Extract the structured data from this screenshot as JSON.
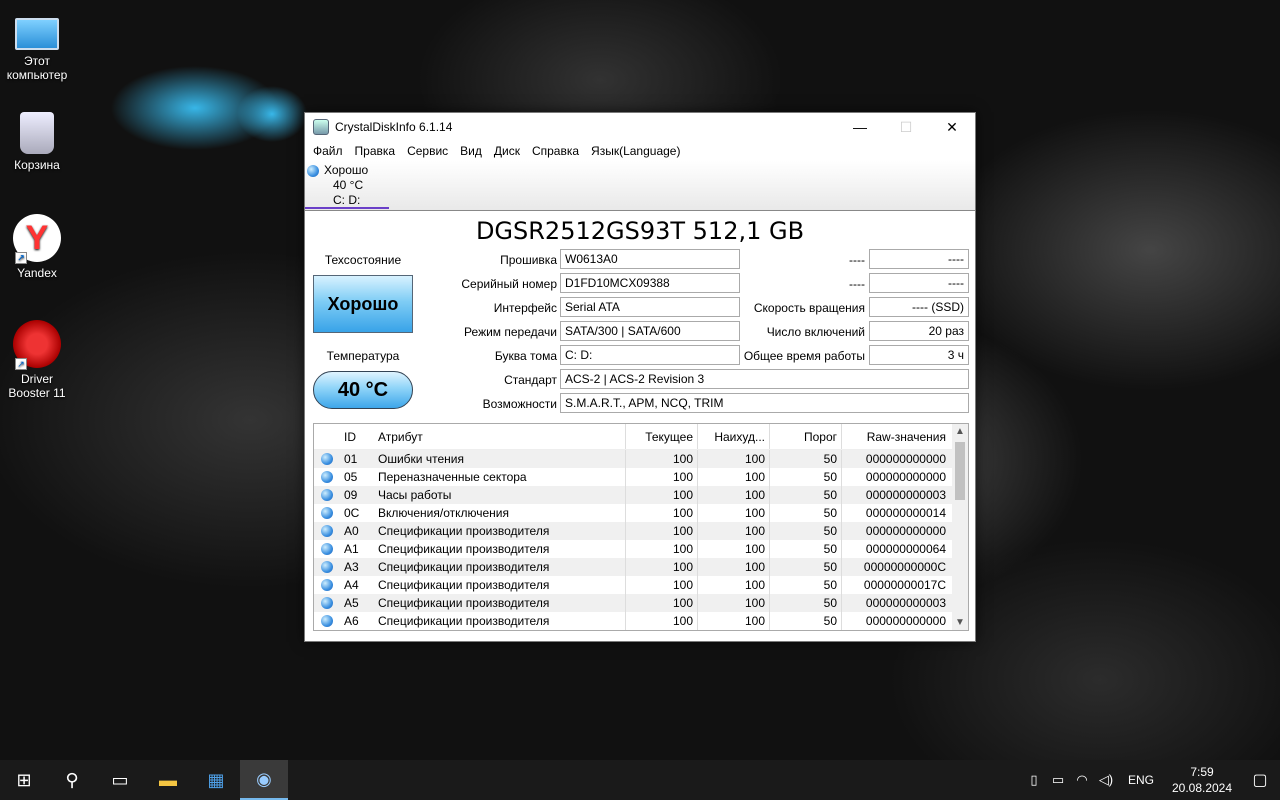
{
  "desktop": {
    "icons": [
      {
        "label": "Этот компьютер",
        "icon": "computer-icon"
      },
      {
        "label": "Корзина",
        "icon": "recycle-bin-icon"
      },
      {
        "label": "Yandex",
        "icon": "yandex-browser-icon"
      },
      {
        "label": "Driver Booster 11",
        "icon": "driver-booster-icon"
      }
    ]
  },
  "window": {
    "title": "CrystalDiskInfo 6.1.14",
    "controls": {
      "minimize": "—",
      "maximize": "☐",
      "close": "✕"
    },
    "menu": [
      "Файл",
      "Правка",
      "Сервис",
      "Вид",
      "Диск",
      "Справка",
      "Язык(Language)"
    ],
    "disk_tab": {
      "status": "Хорошо",
      "temp": "40 °C",
      "letters": "C: D:"
    },
    "model": "DGSR2512GS93T 512,1 GB",
    "health": {
      "title": "Техсостояние",
      "value": "Хорошо"
    },
    "temperature": {
      "title": "Температура",
      "value": "40 °C"
    },
    "fields": {
      "firmware": {
        "label": "Прошивка",
        "value": "W0613A0"
      },
      "serial": {
        "label": "Серийный номер",
        "value": "D1FD10MCX09388"
      },
      "interface": {
        "label": "Интерфейс",
        "value": "Serial ATA"
      },
      "transfer": {
        "label": "Режим передачи",
        "value": "SATA/300 | SATA/600"
      },
      "drive_letter": {
        "label": "Буква тома",
        "value": "C: D:"
      },
      "standard": {
        "label": "Стандарт",
        "value": "ACS-2 | ACS-2 Revision 3"
      },
      "features": {
        "label": "Возможности",
        "value": "S.M.A.R.T., APM, NCQ, TRIM"
      },
      "blank1": {
        "label": "----",
        "value": "----"
      },
      "blank2": {
        "label": "----",
        "value": "----"
      },
      "rotation": {
        "label": "Скорость вращения",
        "value": "---- (SSD)"
      },
      "power_count": {
        "label": "Число включений",
        "value": "20 раз"
      },
      "power_hours": {
        "label": "Общее время работы",
        "value": "3 ч"
      }
    },
    "smart": {
      "headers": {
        "id": "ID",
        "attr": "Атрибут",
        "cur": "Текущее",
        "worst": "Наихуд...",
        "thr": "Порог",
        "raw": "Raw-значения"
      },
      "rows": [
        {
          "id": "01",
          "attr": "Ошибки чтения",
          "cur": "100",
          "worst": "100",
          "thr": "50",
          "raw": "000000000000"
        },
        {
          "id": "05",
          "attr": "Переназначенные сектора",
          "cur": "100",
          "worst": "100",
          "thr": "50",
          "raw": "000000000000"
        },
        {
          "id": "09",
          "attr": "Часы работы",
          "cur": "100",
          "worst": "100",
          "thr": "50",
          "raw": "000000000003"
        },
        {
          "id": "0C",
          "attr": "Включения/отключения",
          "cur": "100",
          "worst": "100",
          "thr": "50",
          "raw": "000000000014"
        },
        {
          "id": "A0",
          "attr": "Спецификации производителя",
          "cur": "100",
          "worst": "100",
          "thr": "50",
          "raw": "000000000000"
        },
        {
          "id": "A1",
          "attr": "Спецификации производителя",
          "cur": "100",
          "worst": "100",
          "thr": "50",
          "raw": "000000000064"
        },
        {
          "id": "A3",
          "attr": "Спецификации производителя",
          "cur": "100",
          "worst": "100",
          "thr": "50",
          "raw": "00000000000C"
        },
        {
          "id": "A4",
          "attr": "Спецификации производителя",
          "cur": "100",
          "worst": "100",
          "thr": "50",
          "raw": "00000000017C"
        },
        {
          "id": "A5",
          "attr": "Спецификации производителя",
          "cur": "100",
          "worst": "100",
          "thr": "50",
          "raw": "000000000003"
        },
        {
          "id": "A6",
          "attr": "Спецификации производителя",
          "cur": "100",
          "worst": "100",
          "thr": "50",
          "raw": "000000000000"
        }
      ]
    }
  },
  "taskbar": {
    "icons": [
      "windows-start-icon",
      "search-icon",
      "task-view-icon",
      "file-explorer-icon",
      "store-icon",
      "crystaldiskinfo-icon"
    ],
    "lang": "ENG",
    "time": "7:59",
    "date": "20.08.2024"
  }
}
